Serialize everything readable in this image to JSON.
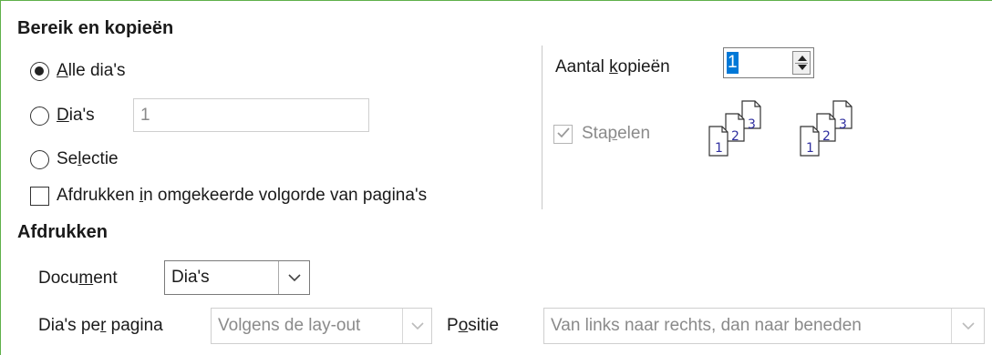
{
  "range_section": {
    "title": "Bereik en kopieën",
    "all_slides": {
      "prefix": "",
      "accel": "A",
      "rest": "lle dia's",
      "checked": true
    },
    "slides": {
      "prefix": "",
      "accel": "D",
      "rest": "ia's",
      "checked": false,
      "input_value": "1"
    },
    "selection": {
      "prefix": "Se",
      "accel": "l",
      "rest": "ectie",
      "checked": false
    },
    "reverse_order": {
      "prefix": "Afdrukken ",
      "accel": "i",
      "rest": "n omgekeerde volgorde van pagina's",
      "checked": false
    }
  },
  "copies": {
    "label_prefix": "Aantal ",
    "label_accel": "k",
    "label_rest": "opieën",
    "value": "1",
    "collate": {
      "prefix": "Sta",
      "accel": "p",
      "rest": "elen",
      "checked": true,
      "enabled": false
    },
    "collate_icon_numbers": [
      "1",
      "2",
      "3"
    ]
  },
  "print_section": {
    "title": "Afdrukken",
    "document": {
      "label_prefix": "Docu",
      "label_accel": "m",
      "label_rest": "ent",
      "value": "Dia's"
    },
    "slides_per_page": {
      "label_prefix": "Dia's pe",
      "label_accel": "r",
      "label_rest": " pagina",
      "value": "Volgens de lay-out"
    },
    "position": {
      "label_prefix": "P",
      "label_accel": "o",
      "label_rest": "sitie",
      "value": "Van links naar rechts, dan naar beneden"
    }
  },
  "colors": {
    "accent": "#0078d7",
    "stack_number": "#3030a0",
    "frame": "#5fb04a"
  }
}
